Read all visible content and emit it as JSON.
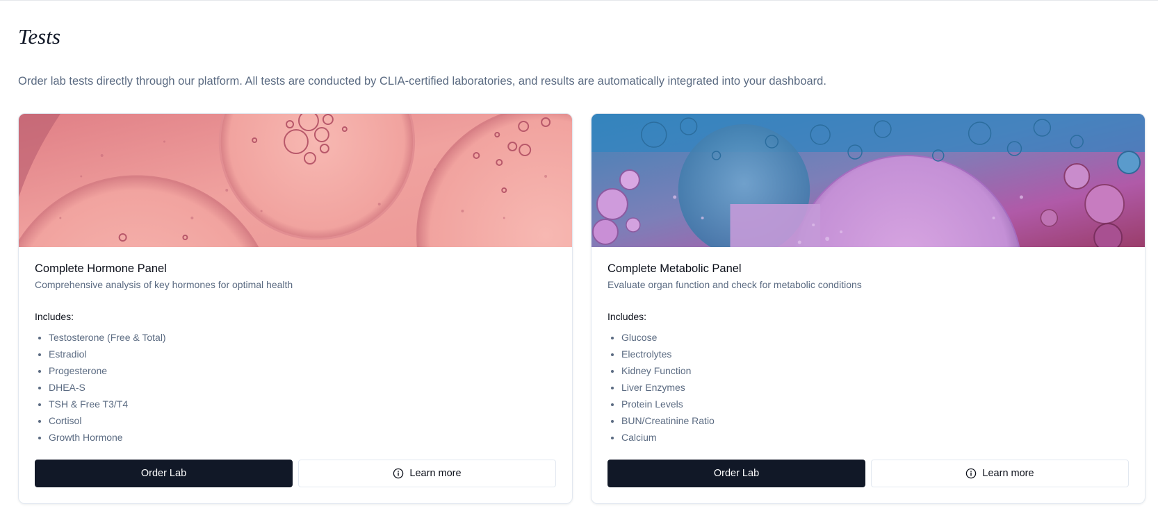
{
  "header": {
    "title": "Tests",
    "description": "Order lab tests directly through our platform. All tests are conducted by CLIA-certified laboratories, and results are automatically integrated into your dashboard."
  },
  "panels": [
    {
      "title": "Complete Hormone Panel",
      "subtitle": "Comprehensive analysis of key hormones for optimal health",
      "includes_label": "Includes:",
      "items": [
        "Testosterone (Free & Total)",
        "Estradiol",
        "Progesterone",
        "DHEA-S",
        "TSH & Free T3/T4",
        "Cortisol",
        "Growth Hormone"
      ],
      "order_label": "Order Lab",
      "learn_label": "Learn more",
      "image_icon": "pink-bubbles-image"
    },
    {
      "title": "Complete Metabolic Panel",
      "subtitle": "Evaluate organ function and check for metabolic conditions",
      "includes_label": "Includes:",
      "items": [
        "Glucose",
        "Electrolytes",
        "Kidney Function",
        "Liver Enzymes",
        "Protein Levels",
        "BUN/Creatinine Ratio",
        "Calcium"
      ],
      "order_label": "Order Lab",
      "learn_label": "Learn more",
      "image_icon": "blue-purple-bubbles-image"
    }
  ],
  "colors": {
    "primary_button": "#111827",
    "muted_text": "#5b6b82",
    "border": "#e2e8f0"
  }
}
